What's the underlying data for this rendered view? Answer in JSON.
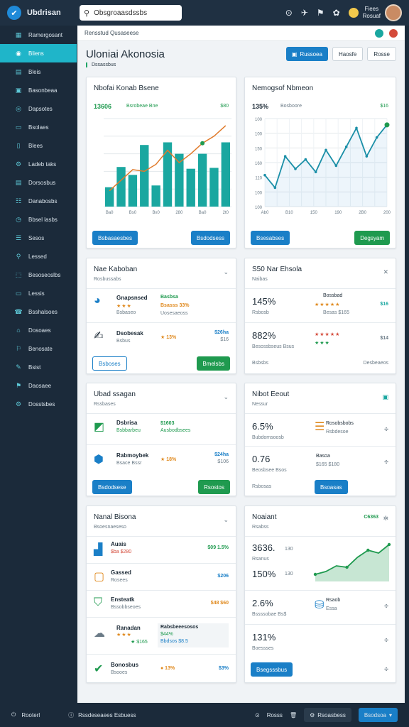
{
  "app": {
    "title": "Ubdrisan",
    "search_placeholder": "Obsgroaasdssbs",
    "user_name_1": "Fiees",
    "user_name_2": "Rosuaf"
  },
  "sidebar": {
    "items": [
      {
        "label": "Ramergosant",
        "icon": "grid-icon"
      },
      {
        "label": "Bliens",
        "icon": "home-icon"
      },
      {
        "label": "Bleis",
        "icon": "users-icon"
      },
      {
        "label": "Basonbeaa",
        "icon": "folder-icon"
      },
      {
        "label": "Dapsotes",
        "icon": "target-icon"
      },
      {
        "label": "Bsolaes",
        "icon": "lock-icon"
      },
      {
        "label": "Blees",
        "icon": "book-icon"
      },
      {
        "label": "Ladeb taks",
        "icon": "settings-icon"
      },
      {
        "label": "Dorsosbus",
        "icon": "doc-icon"
      },
      {
        "label": "Danabosbs",
        "icon": "chart-icon"
      },
      {
        "label": "Bbsel lasbs",
        "icon": "clock-icon"
      },
      {
        "label": "Sesos",
        "icon": "tag-icon"
      },
      {
        "label": "Lessed",
        "icon": "link-icon"
      },
      {
        "label": "Besoseoslbs",
        "icon": "box-icon"
      },
      {
        "label": "Lessis",
        "icon": "tray-icon"
      },
      {
        "label": "Bsshalsoes",
        "icon": "phone-icon"
      },
      {
        "label": "Dosoaes",
        "icon": "home2-icon"
      },
      {
        "label": "Benosate",
        "icon": "pin-icon"
      },
      {
        "label": "Bsist",
        "icon": "pencil-icon"
      },
      {
        "label": "Daosaee",
        "icon": "bell-icon"
      },
      {
        "label": "Dosstsbes",
        "icon": "gear-icon"
      }
    ]
  },
  "crumb": "Rensstud Qusaseese",
  "page": {
    "title": "Uloniai Akonosia",
    "subtab": "Dssassbus",
    "buttons": {
      "primary": "Russoea",
      "secondary": "Haosfe",
      "tertiary": "Rosse"
    }
  },
  "cards": {
    "c1": {
      "title": "Nbofai Konab Bsene",
      "stat": "13606",
      "meta": "Bsrobeae Bne",
      "right": "$80",
      "btn_left": "Bsbasaesbes",
      "btn_right": "Bsdodsess"
    },
    "c2": {
      "title": "Nemogsof Nbmeon",
      "stat": "135%",
      "meta": "Bosboore",
      "right": "$16",
      "btn_left": "Bsesabses",
      "btn_right": "Degsyam"
    },
    "c3": {
      "title": "Nae Kaboban",
      "sub": "Rosbussabs",
      "rows": [
        {
          "t": "Gnapsnsed",
          "m": "Bsbaseo",
          "v": "Basbsa",
          "v2": "Bsasss 33%",
          "v3": "Uosesaeoss"
        },
        {
          "t": "Dsobesak",
          "m": "Bsbus",
          "v": "★ 13%",
          "r": "$26ha",
          "r2": "$16"
        }
      ],
      "btn_left": "Bsboses",
      "btn_right": "Bmelsbs"
    },
    "c4": {
      "title": "S50 Nar Ehsola",
      "sub": "Naibas",
      "rows": [
        {
          "big": "145%",
          "m": "Rsbosb",
          "t": "Bossbad",
          "r": "$16",
          "m2": "Besas $165"
        },
        {
          "big": "882%",
          "m": "Besossbseus Bsus",
          "r": "$14"
        }
      ],
      "link_left": "Bsbsbs",
      "link_right": "Desbeaeos"
    },
    "c5": {
      "title": "Ubad ssagan",
      "sub": "Rssbases",
      "rows": [
        {
          "t": "Dsbrisa",
          "m": "Bsbbarbeu",
          "v": "$1603",
          "v2": "Ausbodbsees"
        },
        {
          "t": "Rabmoybek",
          "m": "Bsace Bssr",
          "v": "★ 18%",
          "r": "$24ha",
          "r2": "$106"
        }
      ],
      "btn_left": "Bsdodsese",
      "btn_right": "Rsostos"
    },
    "c6": {
      "title": "Nibot Eeout",
      "sub": "Nessur",
      "rows": [
        {
          "big": "6.5%",
          "m": "Bubdomsoosb",
          "t": "Rosobsbobs",
          "m2": "Rsbdesoe"
        },
        {
          "big": "0.76",
          "m": "Beosbsee Bsos",
          "t": "Basoa",
          "m2": "$165 $180"
        }
      ],
      "link_left": "Rsbosas",
      "btn_right": "Bsoasas"
    },
    "c7": {
      "title": "Nanal Bisona",
      "sub": "Bsoesnaeseso",
      "rows": [
        {
          "t": "Auais",
          "m": "$ba $280",
          "v": "$09 1.5%"
        },
        {
          "t": "Gassed",
          "m": "Rosees",
          "v": "$206"
        },
        {
          "t": "Ensteatk",
          "m": "Bssobbseoes",
          "v": "$48 $60"
        },
        {
          "t": "Ranadan",
          "m": "★ $165",
          "v": "Rabsbeeesosos",
          "v2": "$44%",
          "v3": "Bbdsos $8.5"
        },
        {
          "t": "Bonosbus",
          "m": "Bsooes",
          "v": "● 13%",
          "r": "$3%"
        }
      ]
    },
    "c8": {
      "title": "Noaiant",
      "sub": "Rsabss",
      "right": "C6363",
      "rows": [
        {
          "big": "3636.",
          "m": "Rsanus",
          "s": "130"
        },
        {
          "big": "150%",
          "s": "130"
        },
        {
          "big": "2.6%",
          "m": "Bssssobae Bs$",
          "t": "Rsaob",
          "m2": "Essa"
        },
        {
          "big": "131%",
          "m": "Boessses"
        }
      ],
      "btn": "Bsegsssbus"
    }
  },
  "footer": {
    "left": "Rooterl",
    "mid": "Rssdeseaees Esbuess",
    "r1": "Rosss",
    "r2": "Rsoasbess",
    "r3": "Bsodsoa"
  },
  "chart_data": [
    {
      "type": "bar",
      "categories": [
        "Ba0",
        "",
        "Bs0",
        "",
        "Bx0",
        "",
        "280",
        "",
        "Ba0",
        "",
        "2t0"
      ],
      "values": [
        22,
        45,
        36,
        70,
        24,
        73,
        60,
        43,
        60,
        44,
        73
      ],
      "line": [
        18,
        30,
        42,
        40,
        48,
        64,
        50,
        60,
        72,
        80,
        92
      ],
      "ylim": [
        0,
        100
      ]
    },
    {
      "type": "line",
      "x": [
        "Ab0",
        "",
        "B10",
        "",
        "150",
        "",
        "190",
        "",
        "2B0",
        "",
        "200"
      ],
      "values": [
        110,
        90,
        140,
        120,
        135,
        115,
        150,
        125,
        155,
        185,
        140,
        170,
        190
      ],
      "ylim": [
        0,
        200
      ],
      "yticks": [
        100,
        100,
        150,
        160,
        110,
        100,
        100
      ]
    }
  ]
}
